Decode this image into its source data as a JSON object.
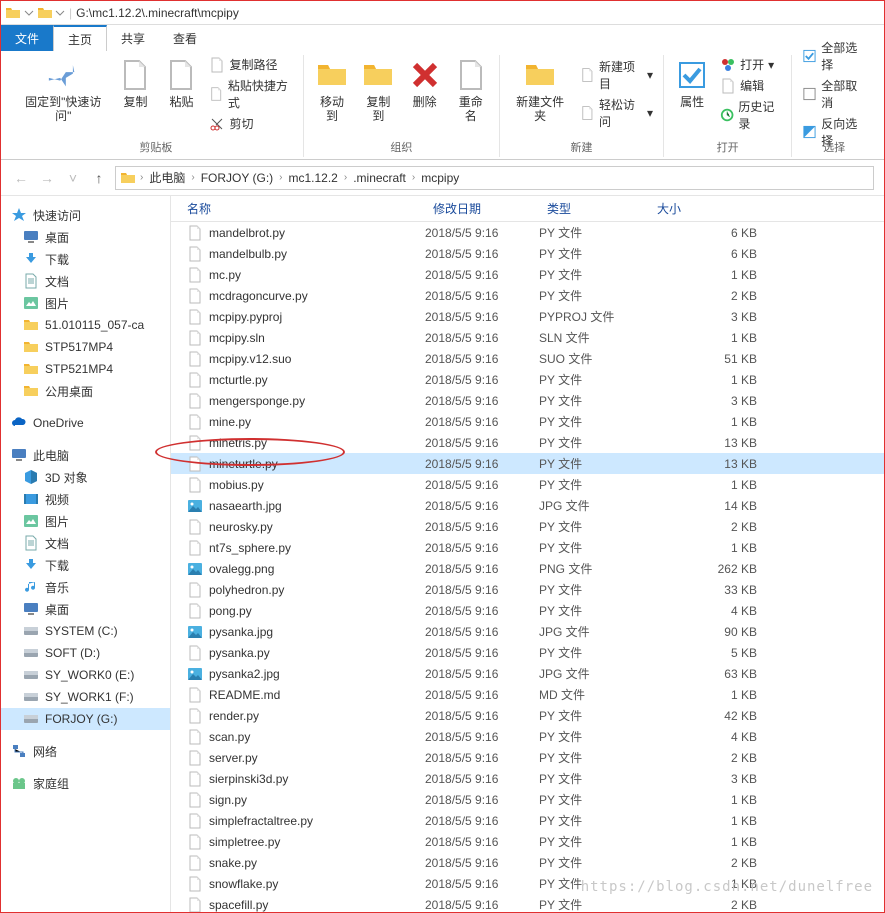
{
  "title_path": "G:\\mc1.12.2\\.minecraft\\mcpipy",
  "tabs": {
    "file": "文件",
    "home": "主页",
    "share": "共享",
    "view": "查看"
  },
  "ribbon": {
    "pin": "固定到\"快速访问\"",
    "copy": "复制",
    "paste": "粘贴",
    "copy_path": "复制路径",
    "paste_shortcut": "粘贴快捷方式",
    "cut": "剪切",
    "clipboard": "剪贴板",
    "move_to": "移动到",
    "copy_to": "复制到",
    "delete": "删除",
    "rename": "重命名",
    "organize": "组织",
    "new_folder": "新建文件夹",
    "new_item": "新建项目",
    "easy_access": "轻松访问",
    "new": "新建",
    "properties": "属性",
    "open": "打开",
    "edit": "编辑",
    "history": "历史记录",
    "open_group": "打开",
    "select_all": "全部选择",
    "select_none": "全部取消",
    "invert": "反向选择",
    "select": "选择"
  },
  "breadcrumb": [
    "此电脑",
    "FORJOY (G:)",
    "mc1.12.2",
    ".minecraft",
    "mcpipy"
  ],
  "columns": {
    "name": "名称",
    "date": "修改日期",
    "type": "类型",
    "size": "大小"
  },
  "sidebar": {
    "quick": {
      "head": "快速访问",
      "items": [
        "桌面",
        "下载",
        "文档",
        "图片",
        "51.010115_057-ca",
        "STP517MP4",
        "STP521MP4",
        "公用桌面"
      ]
    },
    "onedrive": "OneDrive",
    "thispc": {
      "head": "此电脑",
      "items": [
        "3D 对象",
        "视频",
        "图片",
        "文档",
        "下载",
        "音乐",
        "桌面",
        "SYSTEM (C:)",
        "SOFT (D:)",
        "SY_WORK0 (E:)",
        "SY_WORK1 (F:)",
        "FORJOY (G:)"
      ]
    },
    "network": "网络",
    "homegroup": "家庭组"
  },
  "files": [
    {
      "n": "mandelbrot.py",
      "d": "2018/5/5 9:16",
      "t": "PY 文件",
      "s": "6 KB",
      "i": "py"
    },
    {
      "n": "mandelbulb.py",
      "d": "2018/5/5 9:16",
      "t": "PY 文件",
      "s": "6 KB",
      "i": "py"
    },
    {
      "n": "mc.py",
      "d": "2018/5/5 9:16",
      "t": "PY 文件",
      "s": "1 KB",
      "i": "py"
    },
    {
      "n": "mcdragoncurve.py",
      "d": "2018/5/5 9:16",
      "t": "PY 文件",
      "s": "2 KB",
      "i": "py"
    },
    {
      "n": "mcpipy.pyproj",
      "d": "2018/5/5 9:16",
      "t": "PYPROJ 文件",
      "s": "3 KB",
      "i": "blank"
    },
    {
      "n": "mcpipy.sln",
      "d": "2018/5/5 9:16",
      "t": "SLN 文件",
      "s": "1 KB",
      "i": "blank"
    },
    {
      "n": "mcpipy.v12.suo",
      "d": "2018/5/5 9:16",
      "t": "SUO 文件",
      "s": "51 KB",
      "i": "blank"
    },
    {
      "n": "mcturtle.py",
      "d": "2018/5/5 9:16",
      "t": "PY 文件",
      "s": "1 KB",
      "i": "py"
    },
    {
      "n": "mengersponge.py",
      "d": "2018/5/5 9:16",
      "t": "PY 文件",
      "s": "3 KB",
      "i": "py"
    },
    {
      "n": "mine.py",
      "d": "2018/5/5 9:16",
      "t": "PY 文件",
      "s": "1 KB",
      "i": "py"
    },
    {
      "n": "minetris.py",
      "d": "2018/5/5 9:16",
      "t": "PY 文件",
      "s": "13 KB",
      "i": "py"
    },
    {
      "n": "mineturtle.py",
      "d": "2018/5/5 9:16",
      "t": "PY 文件",
      "s": "13 KB",
      "i": "py",
      "sel": true
    },
    {
      "n": "mobius.py",
      "d": "2018/5/5 9:16",
      "t": "PY 文件",
      "s": "1 KB",
      "i": "py"
    },
    {
      "n": "nasaearth.jpg",
      "d": "2018/5/5 9:16",
      "t": "JPG 文件",
      "s": "14 KB",
      "i": "img"
    },
    {
      "n": "neurosky.py",
      "d": "2018/5/5 9:16",
      "t": "PY 文件",
      "s": "2 KB",
      "i": "py"
    },
    {
      "n": "nt7s_sphere.py",
      "d": "2018/5/5 9:16",
      "t": "PY 文件",
      "s": "1 KB",
      "i": "py"
    },
    {
      "n": "ovalegg.png",
      "d": "2018/5/5 9:16",
      "t": "PNG 文件",
      "s": "262 KB",
      "i": "img"
    },
    {
      "n": "polyhedron.py",
      "d": "2018/5/5 9:16",
      "t": "PY 文件",
      "s": "33 KB",
      "i": "py"
    },
    {
      "n": "pong.py",
      "d": "2018/5/5 9:16",
      "t": "PY 文件",
      "s": "4 KB",
      "i": "py"
    },
    {
      "n": "pysanka.jpg",
      "d": "2018/5/5 9:16",
      "t": "JPG 文件",
      "s": "90 KB",
      "i": "img"
    },
    {
      "n": "pysanka.py",
      "d": "2018/5/5 9:16",
      "t": "PY 文件",
      "s": "5 KB",
      "i": "py"
    },
    {
      "n": "pysanka2.jpg",
      "d": "2018/5/5 9:16",
      "t": "JPG 文件",
      "s": "63 KB",
      "i": "img"
    },
    {
      "n": "README.md",
      "d": "2018/5/5 9:16",
      "t": "MD 文件",
      "s": "1 KB",
      "i": "blank"
    },
    {
      "n": "render.py",
      "d": "2018/5/5 9:16",
      "t": "PY 文件",
      "s": "42 KB",
      "i": "py"
    },
    {
      "n": "scan.py",
      "d": "2018/5/5 9:16",
      "t": "PY 文件",
      "s": "4 KB",
      "i": "py"
    },
    {
      "n": "server.py",
      "d": "2018/5/5 9:16",
      "t": "PY 文件",
      "s": "2 KB",
      "i": "py"
    },
    {
      "n": "sierpinski3d.py",
      "d": "2018/5/5 9:16",
      "t": "PY 文件",
      "s": "3 KB",
      "i": "py"
    },
    {
      "n": "sign.py",
      "d": "2018/5/5 9:16",
      "t": "PY 文件",
      "s": "1 KB",
      "i": "py"
    },
    {
      "n": "simplefractaltree.py",
      "d": "2018/5/5 9:16",
      "t": "PY 文件",
      "s": "1 KB",
      "i": "py"
    },
    {
      "n": "simpletree.py",
      "d": "2018/5/5 9:16",
      "t": "PY 文件",
      "s": "1 KB",
      "i": "py"
    },
    {
      "n": "snake.py",
      "d": "2018/5/5 9:16",
      "t": "PY 文件",
      "s": "2 KB",
      "i": "py"
    },
    {
      "n": "snowflake.py",
      "d": "2018/5/5 9:16",
      "t": "PY 文件",
      "s": "1 KB",
      "i": "py"
    },
    {
      "n": "spacefill.py",
      "d": "2018/5/5 9:16",
      "t": "PY 文件",
      "s": "2 KB",
      "i": "py"
    }
  ],
  "watermark": "https://blog.csdn.net/dunelfree"
}
